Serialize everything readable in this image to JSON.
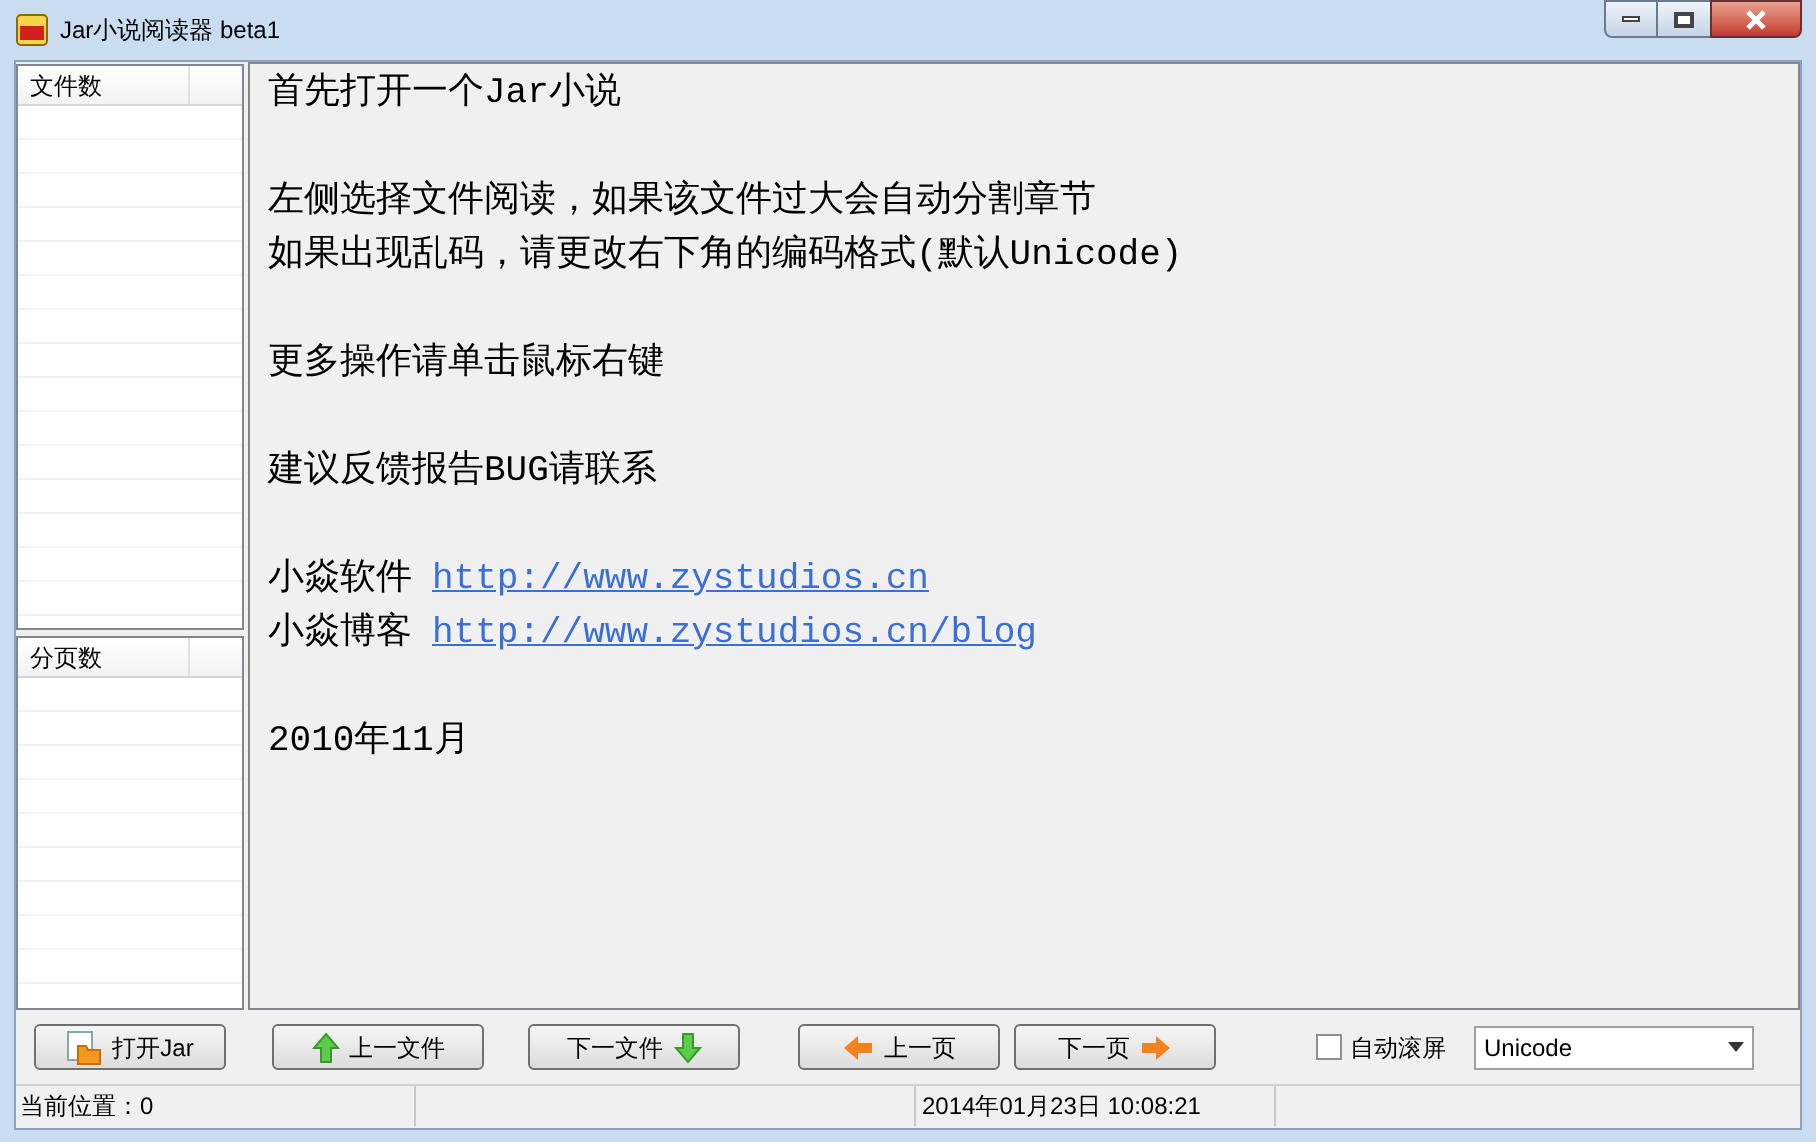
{
  "window": {
    "title": "Jar小说阅读器 beta1"
  },
  "file_list": {
    "header": "文件数"
  },
  "page_list": {
    "header": "分页数"
  },
  "content": {
    "lines": [
      {
        "kind": "text",
        "text": "首先打开一个Jar小说"
      },
      {
        "kind": "blank"
      },
      {
        "kind": "text",
        "text": "左侧选择文件阅读，如果该文件过大会自动分割章节"
      },
      {
        "kind": "text",
        "text": "如果出现乱码，请更改右下角的编码格式(默认Unicode)"
      },
      {
        "kind": "blank"
      },
      {
        "kind": "text",
        "text": "更多操作请单击鼠标右键"
      },
      {
        "kind": "blank"
      },
      {
        "kind": "text",
        "text": "建议反馈报告BUG请联系"
      },
      {
        "kind": "blank"
      },
      {
        "kind": "link",
        "text": "小焱软件",
        "url": "http://www.zystudios.cn"
      },
      {
        "kind": "link",
        "text": "小焱博客",
        "url": "http://www.zystudios.cn/blog"
      },
      {
        "kind": "blank"
      },
      {
        "kind": "text",
        "text": "2010年11月"
      }
    ]
  },
  "buttons": [
    {
      "label": "打开Jar",
      "kind": "open"
    },
    {
      "label": "上一文件",
      "kind": "up"
    },
    {
      "label": "下一文件",
      "kind": "down"
    },
    {
      "label": "上一页",
      "kind": "left"
    },
    {
      "label": "下一页",
      "kind": "right"
    }
  ],
  "auto_scroll": {
    "label": "自动滚屏",
    "checked": false
  },
  "encoding": {
    "value": "Unicode"
  },
  "status_bar": {
    "position": "当前位置：0",
    "time": "2014年01月23日 10:08:21"
  }
}
